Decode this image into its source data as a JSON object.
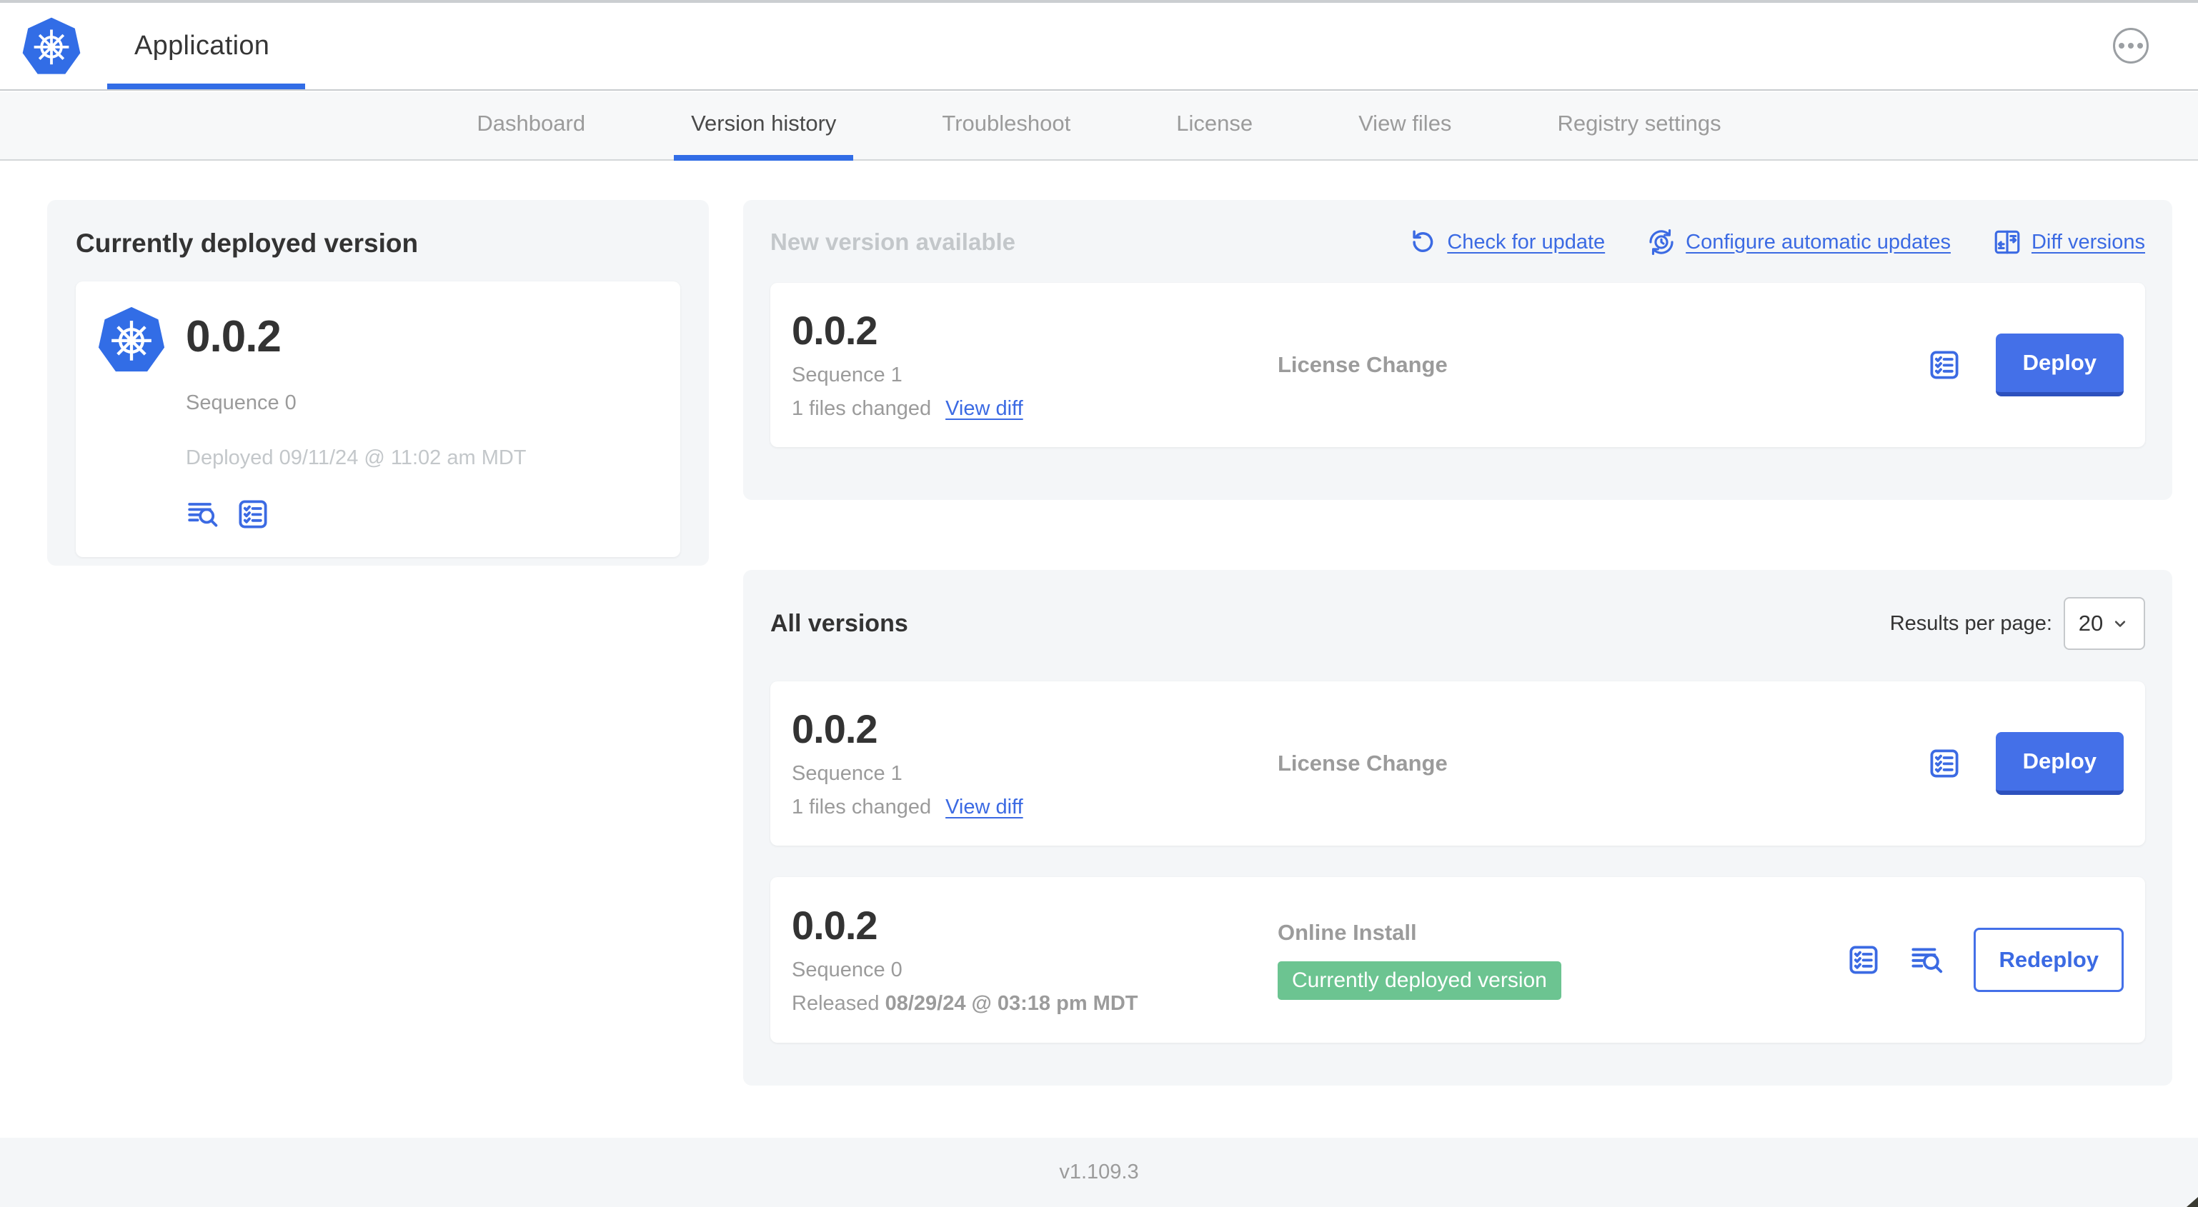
{
  "header": {
    "app_title": "Application"
  },
  "nav": {
    "active_tab": "Version history",
    "tabs": [
      {
        "label": "Dashboard"
      },
      {
        "label": "Version history"
      },
      {
        "label": "Troubleshoot"
      },
      {
        "label": "License"
      },
      {
        "label": "View files"
      },
      {
        "label": "Registry settings"
      }
    ]
  },
  "current": {
    "title": "Currently deployed version",
    "version": "0.0.2",
    "sequence": "Sequence 0",
    "deployed": "Deployed 09/11/24 @ 11:02 am MDT"
  },
  "new_version": {
    "title": "New version available",
    "actions": {
      "check_label": "Check for update",
      "configure_label": "Configure automatic updates",
      "diff_label": "Diff versions"
    },
    "card": {
      "version": "0.0.2",
      "sequence": "Sequence 1",
      "files_changed": "1 files changed",
      "view_diff_label": "View diff",
      "change_type": "License Change",
      "deploy_label": "Deploy"
    }
  },
  "all_versions": {
    "title": "All versions",
    "results_per_page_label": "Results per page:",
    "page_size": "20",
    "rows": [
      {
        "version": "0.0.2",
        "sequence": "Sequence 1",
        "files_changed": "1 files changed",
        "view_diff_label": "View diff",
        "change_type": "License Change",
        "action_label": "Deploy"
      },
      {
        "version": "0.0.2",
        "sequence": "Sequence 0",
        "released_prefix": "Released",
        "released_date": "08/29/24 @ 03:18 pm MDT",
        "change_type": "Online Install",
        "badge": "Currently deployed version",
        "action_label": "Redeploy"
      }
    ]
  },
  "footer": {
    "app_version": "v1.109.3"
  },
  "colors": {
    "primary_blue": "#326DE6",
    "link_blue": "#3b6ae3",
    "button_blue": "#4470e8",
    "badge_green": "#6cc491",
    "text_dark": "#323232",
    "text_gray": "#9b9b9b",
    "text_muted": "#c3c7ca",
    "panel_bg": "#f4f6f8"
  }
}
